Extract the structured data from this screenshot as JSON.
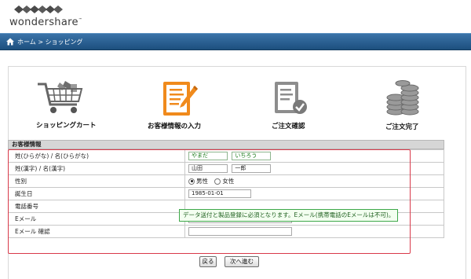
{
  "brand": {
    "name": "wondershare",
    "trademark": "™"
  },
  "breadcrumb": {
    "home": "ホーム",
    "separator": ">",
    "current": "ショッピング"
  },
  "steps": [
    {
      "label": "ショッピングカート",
      "icon": "shopping-cart-icon",
      "active": false
    },
    {
      "label": "お客様情報の入力",
      "icon": "clipboard-edit-icon",
      "active": true
    },
    {
      "label": "ご注文確認",
      "icon": "document-check-icon",
      "active": false
    },
    {
      "label": "ご注文完了",
      "icon": "coin-stack-icon",
      "active": false
    }
  ],
  "form": {
    "section_title": "お客様情報",
    "kana_label": "姓(ひらがな) / 名(ひらがな)",
    "kana_last": "やまだ",
    "kana_first": "いちろう",
    "kanji_label": "姓(漢字) / 名(漢字)",
    "kanji_last": "山田",
    "kanji_first": "一郎",
    "gender_label": "性別",
    "gender_male": "男性",
    "gender_female": "女性",
    "gender_selected": "男性",
    "birthday_label": "誕生日",
    "birthday": "1985-01-01",
    "phone_label": "電話番号",
    "phone_tooltip": "データ送付と製品登録に必須となります。Eメール(携帯電話のEメールは不可)。",
    "email_label": "Eメール",
    "email": "",
    "email_confirm_label": "Eメール 確認",
    "email_confirm": ""
  },
  "buttons": {
    "back": "戻る",
    "next": "次へ進む"
  },
  "colors": {
    "nav": "#1d4f7e",
    "accent": "#f08a1c",
    "highlight": "#d9394a",
    "tooltip_border": "#3ea84a"
  }
}
